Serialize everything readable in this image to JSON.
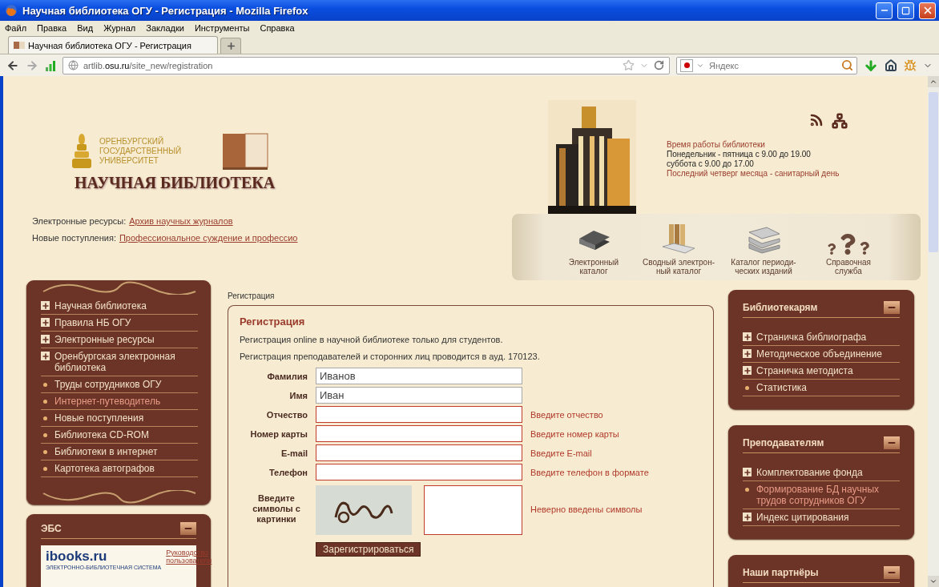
{
  "window": {
    "title": "Научная библиотека ОГУ - Регистрация - Mozilla Firefox"
  },
  "menu": [
    "Файл",
    "Правка",
    "Вид",
    "Журнал",
    "Закладки",
    "Инструменты",
    "Справка"
  ],
  "tabs": [
    {
      "label": "Научная библиотека ОГУ - Регистрация",
      "selected": true
    }
  ],
  "address": {
    "subdomain": "artlib.",
    "domain": "osu.ru",
    "path": "/site_new/registration"
  },
  "search": {
    "placeholder": "Яндекс"
  },
  "header": {
    "university_lines": [
      "ОРЕНБУРГСКИЙ",
      "ГОСУДАРСТВЕННЫЙ",
      "УНИВЕРСИТЕТ"
    ],
    "library_name": "НАУЧНАЯ БИБЛИОТЕКА",
    "hours": [
      {
        "text": "Время работы библиотеки",
        "kind": "highlight"
      },
      {
        "text": "Понедельник - пятница с 9.00 до 19.00",
        "kind": "plain"
      },
      {
        "text": "суббота с 9.00 до 17.00",
        "kind": "plain"
      },
      {
        "text": "Последний четверг месяца - санитарный день",
        "kind": "highlight"
      }
    ],
    "resource_links": [
      {
        "label": "Электронные ресурсы:",
        "link": "Архив научных журналов"
      },
      {
        "label": "Новые поступления:",
        "link": "Профессиональное суждение и профессио"
      }
    ],
    "catalogs": [
      {
        "kind": "books",
        "lines": [
          "Электронный",
          "каталог"
        ]
      },
      {
        "kind": "folders",
        "lines": [
          "Сводный электрон-",
          "ный каталог"
        ]
      },
      {
        "kind": "magazines",
        "lines": [
          "Каталог периоди-",
          "ческих изданий"
        ]
      },
      {
        "kind": "help",
        "lines": [
          "Справочная",
          "служба"
        ]
      }
    ]
  },
  "left_menu": [
    {
      "kind": "section",
      "label": "Научная библиотека",
      "selected": false
    },
    {
      "kind": "section",
      "label": "Правила НБ ОГУ",
      "selected": false
    },
    {
      "kind": "section",
      "label": "Электронные ресурсы",
      "selected": false
    },
    {
      "kind": "section",
      "label": "Оренбургская электронная библиотека",
      "selected": false
    },
    {
      "kind": "link",
      "label": "Труды сотрудников ОГУ",
      "selected": false
    },
    {
      "kind": "link",
      "label": "Интернет-путеводитель",
      "selected": true
    },
    {
      "kind": "link",
      "label": "Новые поступления",
      "selected": false
    },
    {
      "kind": "link",
      "label": "Библиотека CD-ROM",
      "selected": false
    },
    {
      "kind": "link",
      "label": "Библиотеки в интернет",
      "selected": false
    },
    {
      "kind": "link",
      "label": "Картотека автографов",
      "selected": false
    }
  ],
  "ebs": {
    "title": "ЭБС",
    "logo": "ibooks.ru",
    "logo_caption": "ЭЛЕКТРОННО-БИБЛИОТЕЧНАЯ СИСТЕМА",
    "link": "Руководство пользователя"
  },
  "breadcrumb": "Регистрация",
  "form": {
    "title": "Регистрация",
    "notes": [
      "Регистрация online в научной библиотеке только для студентов.",
      "Регистрация преподавателей и сторонних лиц проводится в ауд. 170123."
    ],
    "fields": [
      {
        "label": "Фамилия",
        "value": "Иванов",
        "error": false
      },
      {
        "label": "Имя",
        "value": "Иван",
        "error": false
      },
      {
        "label": "Отчество",
        "error": true,
        "message": "Введите отчество"
      },
      {
        "label": "Номер карты",
        "error": true,
        "message": "Введите номер карты"
      },
      {
        "label": "E-mail",
        "error": true,
        "message": "Введите E-mail"
      },
      {
        "label": "Телефон",
        "error": true,
        "message": "Введите телефон в формате"
      }
    ],
    "captcha": {
      "label": "Введите символы с картинки",
      "error": true,
      "message": "Неверно введены символы"
    },
    "submit": "Зарегистрироваться"
  },
  "right_boxes": [
    {
      "title": "Библиотекарям",
      "items": [
        {
          "kind": "section",
          "label": "Страничка библиографа",
          "selected": false
        },
        {
          "kind": "section",
          "label": "Методическое объединение",
          "selected": false
        },
        {
          "kind": "section",
          "label": "Страничка методиста",
          "selected": false
        },
        {
          "kind": "link",
          "label": "Статистика",
          "selected": false
        }
      ]
    },
    {
      "title": "Преподавателям",
      "items": [
        {
          "kind": "section",
          "label": "Комплектование фонда",
          "selected": false
        },
        {
          "kind": "link",
          "label": "Формирование БД научных трудов сотрудников ОГУ",
          "selected": true
        },
        {
          "kind": "section",
          "label": "Индекс цитирования",
          "selected": false
        }
      ]
    },
    {
      "title": "Наши партнёры"
    }
  ]
}
